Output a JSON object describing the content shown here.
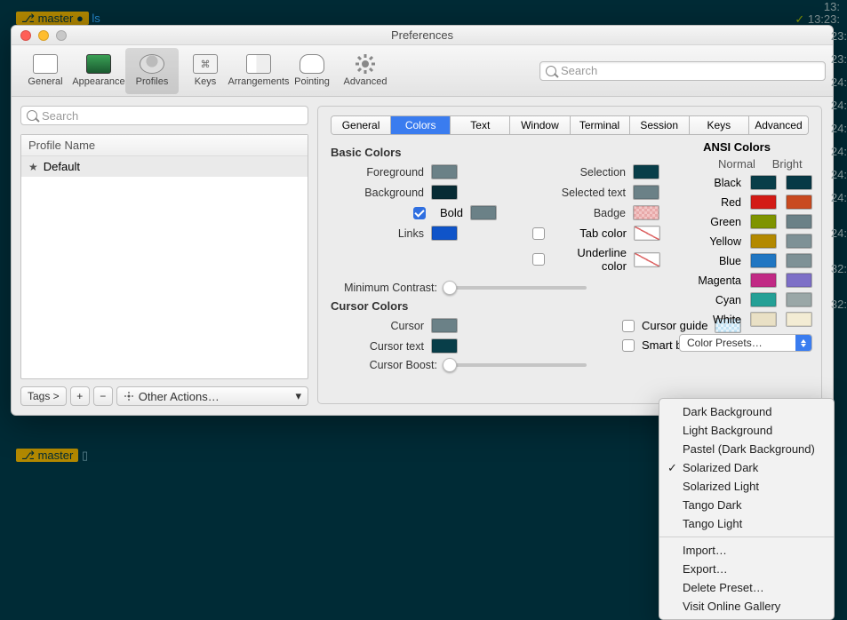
{
  "window_title": "Preferences",
  "toolbar": {
    "items": [
      "General",
      "Appearance",
      "Profiles",
      "Keys",
      "Arrangements",
      "Pointing",
      "Advanced"
    ],
    "labels": {
      "general": "General",
      "appearance": "Appearance",
      "profiles": "Profiles",
      "keys": "Keys",
      "arrangements": "Arrangements",
      "pointing": "Pointing",
      "advanced": "Advanced"
    },
    "search_placeholder": "Search"
  },
  "sidebar": {
    "search_placeholder": "Search",
    "header": "Profile Name",
    "default_profile": "Default",
    "tags_btn": "Tags >",
    "other_actions": "Other Actions…",
    "plus": "+",
    "minus": "−"
  },
  "tabs": [
    "General",
    "Colors",
    "Text",
    "Window",
    "Terminal",
    "Session",
    "Keys",
    "Advanced"
  ],
  "selected_tab": "Colors",
  "basic": {
    "title": "Basic Colors",
    "foreground": {
      "label": "Foreground",
      "color": "#6b8187"
    },
    "background": {
      "label": "Background",
      "color": "#072b34"
    },
    "bold": {
      "label": "Bold",
      "color": "#6b8187",
      "checked": true
    },
    "links": {
      "label": "Links",
      "color": "#0f54c9"
    },
    "selection": {
      "label": "Selection",
      "color": "#083e49"
    },
    "selected_text": {
      "label": "Selected text",
      "color": "#6b8187"
    },
    "badge": {
      "label": "Badge"
    },
    "tab_color": {
      "label": "Tab color",
      "checked": false
    },
    "underline": {
      "label": "Underline color",
      "checked": false
    },
    "min_contrast": "Minimum Contrast:"
  },
  "cursor": {
    "title": "Cursor Colors",
    "cursor": {
      "label": "Cursor",
      "color": "#6b8187"
    },
    "cursor_text": {
      "label": "Cursor text",
      "color": "#083e49"
    },
    "boost": "Cursor Boost:",
    "guide": {
      "label": "Cursor guide",
      "checked": false
    },
    "smart": {
      "label": "Smart box cursor color",
      "checked": false
    }
  },
  "ansi": {
    "title": "ANSI Colors",
    "normal_h": "Normal",
    "bright_h": "Bright",
    "rows": [
      {
        "name": "Black",
        "n": "#083e49",
        "b": "#073946"
      },
      {
        "name": "Red",
        "n": "#d31b16",
        "b": "#c94a20"
      },
      {
        "name": "Green",
        "n": "#7f9400",
        "b": "#6b8187"
      },
      {
        "name": "Yellow",
        "n": "#b38900",
        "b": "#7e9196"
      },
      {
        "name": "Blue",
        "n": "#2076c2",
        "b": "#7e9196"
      },
      {
        "name": "Magenta",
        "n": "#c12a85",
        "b": "#7d6fc7"
      },
      {
        "name": "Cyan",
        "n": "#24a096",
        "b": "#9aa7a7"
      },
      {
        "name": "White",
        "n": "#e9e0c5",
        "b": "#f3ecd4"
      }
    ]
  },
  "preset_btn": "Color Presets…",
  "menu": {
    "items": [
      "Dark Background",
      "Light Background",
      "Pastel (Dark Background)",
      "Solarized Dark",
      "Solarized Light",
      "Tango Dark",
      "Tango Light"
    ],
    "checked": "Solarized Dark",
    "actions": [
      "Import…",
      "Export…",
      "Delete Preset…",
      "Visit Online Gallery"
    ]
  },
  "terminal": {
    "prompt1": "master",
    "cmd": "ls",
    "time1": "13:23:",
    "times": [
      "23:",
      "23:",
      "24:",
      "24:",
      "24:",
      "24:",
      "24:",
      "24:",
      "24:",
      "32:",
      "32:"
    ]
  }
}
